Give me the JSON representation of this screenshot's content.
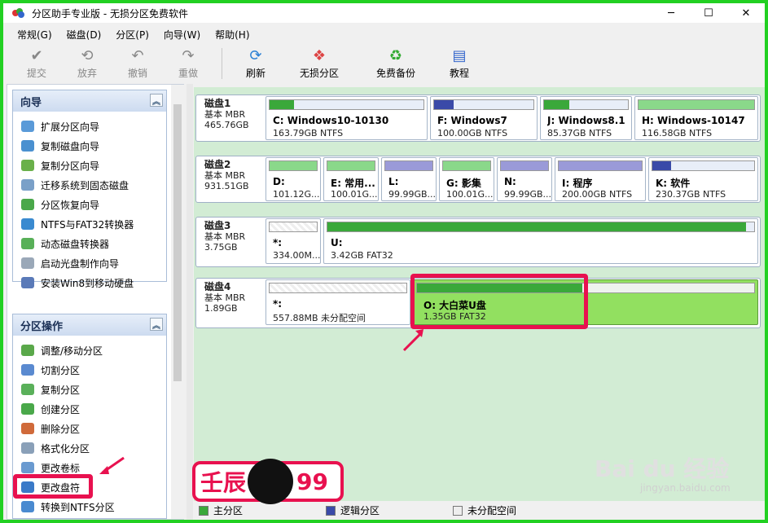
{
  "window": {
    "title": "分区助手专业版 - 无损分区免费软件",
    "minimize": "─",
    "maximize": "☐",
    "close": "✕"
  },
  "menu": [
    "常规(G)",
    "磁盘(D)",
    "分区(P)",
    "向导(W)",
    "帮助(H)"
  ],
  "toolbar": {
    "submit": "提交",
    "discard": "放弃",
    "undo": "撤销",
    "redo": "重做",
    "refresh": "刷新",
    "lossless": "无损分区",
    "backup": "免费备份",
    "tutorial": "教程"
  },
  "wizard": {
    "title": "向导",
    "items": [
      "扩展分区向导",
      "复制磁盘向导",
      "复制分区向导",
      "迁移系统到固态磁盘",
      "分区恢复向导",
      "NTFS与FAT32转换器",
      "动态磁盘转换器",
      "启动光盘制作向导",
      "安装Win8到移动硬盘"
    ]
  },
  "partops": {
    "title": "分区操作",
    "items": [
      "调整/移动分区",
      "切割分区",
      "复制分区",
      "创建分区",
      "删除分区",
      "格式化分区",
      "更改卷标",
      "更改盘符",
      "转换到NTFS分区"
    ]
  },
  "disks": [
    {
      "name": "磁盘1",
      "type": "基本 MBR",
      "size": "465.76GB",
      "parts": [
        {
          "label": "C: Windows10-10130",
          "info": "163.79GB NTFS"
        },
        {
          "label": "F: Windows7",
          "info": "100.00GB NTFS"
        },
        {
          "label": "J: Windows8.1",
          "info": "85.37GB NTFS"
        },
        {
          "label": "H: Windows-10147",
          "info": "116.58GB NTFS"
        }
      ]
    },
    {
      "name": "磁盘2",
      "type": "基本 MBR",
      "size": "931.51GB",
      "parts": [
        {
          "label": "D:",
          "info": "101.12G..."
        },
        {
          "label": "E: 常用...",
          "info": "100.01G..."
        },
        {
          "label": "L:",
          "info": "99.99GB..."
        },
        {
          "label": "G: 影集",
          "info": "100.01G..."
        },
        {
          "label": "N:",
          "info": "99.99GB..."
        },
        {
          "label": "I: 程序",
          "info": "200.00GB NTFS"
        },
        {
          "label": "K: 软件",
          "info": "230.37GB NTFS"
        }
      ]
    },
    {
      "name": "磁盘3",
      "type": "基本 MBR",
      "size": "3.75GB",
      "parts": [
        {
          "label": "*:",
          "info": "334.00M..."
        },
        {
          "label": "U:",
          "info": "3.42GB FAT32"
        }
      ]
    },
    {
      "name": "磁盘4",
      "type": "基本 MBR",
      "size": "1.89GB",
      "parts": [
        {
          "label": "*:",
          "info": "557.88MB 未分配空间"
        },
        {
          "label": "O: 大白菜U盘",
          "info": "1.35GB FAT32"
        }
      ]
    }
  ],
  "legend": {
    "primary": "主分区",
    "logical": "逻辑分区",
    "unalloc": "未分配空间"
  },
  "colors": {
    "primary": "#3aa83a",
    "logical": "#3a4aa8",
    "highlight": "#e8114f"
  },
  "overlay": {
    "brand": "壬辰",
    "number": "99",
    "watermark": "Bai du 经验",
    "url": "jingyan.baidu.com"
  }
}
